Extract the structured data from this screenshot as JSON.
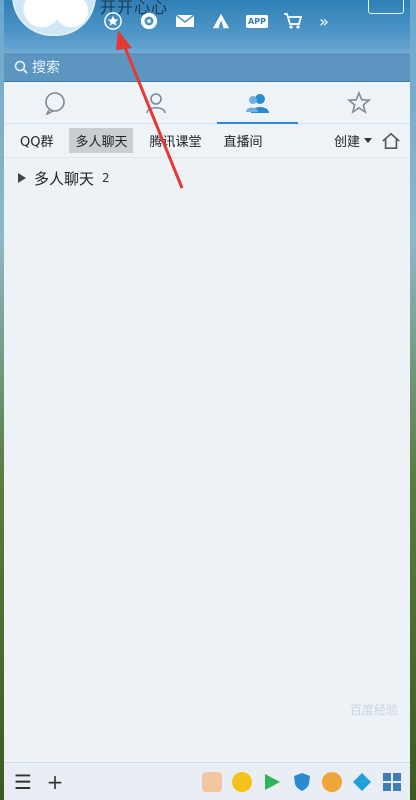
{
  "header": {
    "nickname": "开开心心",
    "icons": [
      "star-icon",
      "qzone-icon",
      "mail-icon",
      "tent-icon",
      "app-icon",
      "cart-icon",
      "more-icon"
    ],
    "app_label": "APP",
    "more_label": "»"
  },
  "search": {
    "placeholder": "搜索"
  },
  "tabs": [
    {
      "name": "message-icon"
    },
    {
      "name": "contact-icon"
    },
    {
      "name": "group-icon"
    },
    {
      "name": "favorite-icon"
    }
  ],
  "subtabs": {
    "items": [
      "QQ群",
      "多人聊天",
      "腾讯课堂",
      "直播间"
    ],
    "selected": "多人聊天",
    "create_label": "创建"
  },
  "list": {
    "group_label": "多人聊天",
    "group_count": "2"
  },
  "bottom": {
    "menu_icon": "☰",
    "add_icon": "+",
    "apps": [
      "game-icon",
      "circle-green-icon",
      "play-icon",
      "shield-icon",
      "dog-icon",
      "diamond-icon",
      "grid-icon"
    ]
  },
  "watermark": "百度经验",
  "colors": {
    "accent": "#2a8bd0",
    "header": "#2f80b6",
    "annotation": "#e53935"
  }
}
